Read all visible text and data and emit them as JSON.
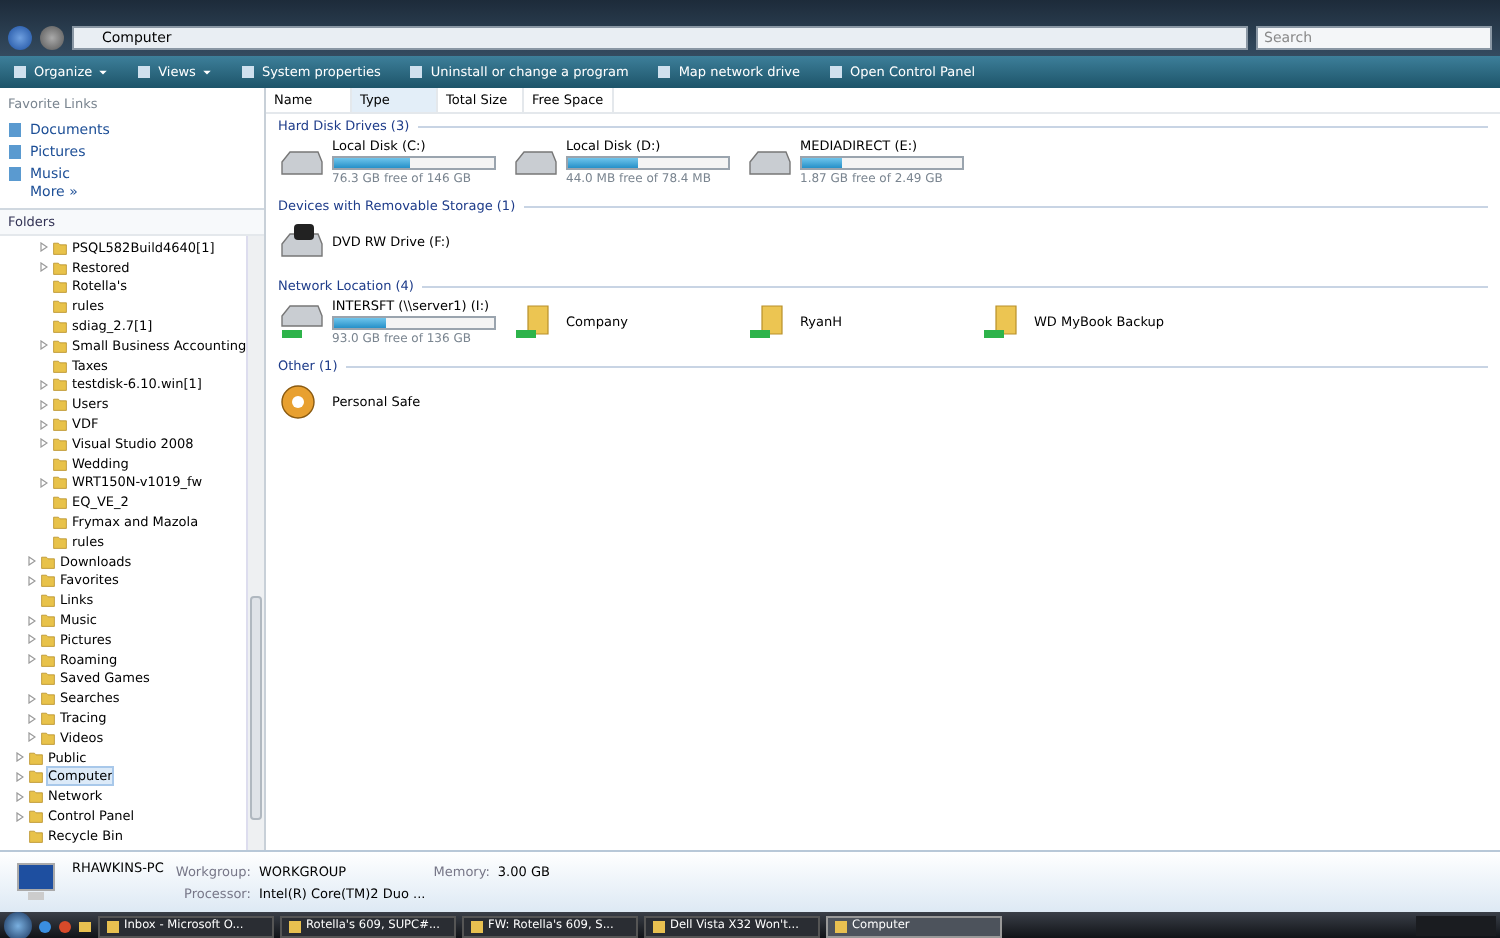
{
  "address_bar": {
    "path": "Computer",
    "search_placeholder": "Search"
  },
  "toolbar": {
    "items": [
      {
        "label": "Organize",
        "dropdown": true
      },
      {
        "label": "Views",
        "dropdown": true
      },
      {
        "label": "System properties",
        "dropdown": false
      },
      {
        "label": "Uninstall or change a program",
        "dropdown": false
      },
      {
        "label": "Map network drive",
        "dropdown": false
      },
      {
        "label": "Open Control Panel",
        "dropdown": false
      }
    ]
  },
  "favorite_links": {
    "title": "Favorite Links",
    "items": [
      {
        "label": "Documents"
      },
      {
        "label": "Pictures"
      },
      {
        "label": "Music"
      }
    ],
    "more": "More",
    "more_icon": "»"
  },
  "folders": {
    "title": "Folders",
    "nested_items": [
      {
        "label": "PSQL582Build4640[1]",
        "expandable": true,
        "selected": false
      },
      {
        "label": "Restored",
        "expandable": true,
        "selected": false
      },
      {
        "label": "Rotella's",
        "expandable": false,
        "selected": false
      },
      {
        "label": "rules",
        "expandable": false,
        "selected": false
      },
      {
        "label": "sdiag_2.7[1]",
        "expandable": false,
        "selected": false
      },
      {
        "label": "Small Business Accounting",
        "expandable": true,
        "selected": false
      },
      {
        "label": "Taxes",
        "expandable": false,
        "selected": false
      },
      {
        "label": "testdisk-6.10.win[1]",
        "expandable": true,
        "selected": false
      },
      {
        "label": "Users",
        "expandable": true,
        "selected": false
      },
      {
        "label": "VDF",
        "expandable": true,
        "selected": false
      },
      {
        "label": "Visual Studio 2008",
        "expandable": true,
        "selected": false
      },
      {
        "label": "Wedding",
        "expandable": false,
        "selected": false
      },
      {
        "label": "WRT150N-v1019_fw",
        "expandable": true,
        "selected": false
      },
      {
        "label": "EQ_VE_2",
        "expandable": false,
        "selected": false
      },
      {
        "label": "Frymax and Mazola",
        "expandable": false,
        "selected": false
      },
      {
        "label": "rules",
        "expandable": false,
        "selected": false
      }
    ],
    "user_items": [
      {
        "label": "Downloads",
        "expandable": true,
        "selected": false
      },
      {
        "label": "Favorites",
        "expandable": true,
        "selected": false
      },
      {
        "label": "Links",
        "expandable": false,
        "selected": false
      },
      {
        "label": "Music",
        "expandable": true,
        "selected": false
      },
      {
        "label": "Pictures",
        "expandable": true,
        "selected": false
      },
      {
        "label": "Roaming",
        "expandable": true,
        "selected": false
      },
      {
        "label": "Saved Games",
        "expandable": false,
        "selected": false
      },
      {
        "label": "Searches",
        "expandable": true,
        "selected": false
      },
      {
        "label": "Tracing",
        "expandable": true,
        "selected": false
      },
      {
        "label": "Videos",
        "expandable": true,
        "selected": false
      }
    ],
    "root_items": [
      {
        "label": "Public",
        "expandable": true,
        "selected": false
      },
      {
        "label": "Computer",
        "expandable": true,
        "selected": true
      },
      {
        "label": "Network",
        "expandable": true,
        "selected": false
      },
      {
        "label": "Control Panel",
        "expandable": true,
        "selected": false
      },
      {
        "label": "Recycle Bin",
        "expandable": false,
        "selected": false
      }
    ]
  },
  "columns": [
    {
      "label": "Name",
      "sorted": false
    },
    {
      "label": "Type",
      "sorted": true
    },
    {
      "label": "Total Size",
      "sorted": false
    },
    {
      "label": "Free Space",
      "sorted": false
    }
  ],
  "groups": [
    {
      "title": "Hard Disk Drives (3)",
      "items": [
        {
          "kind": "drive",
          "name": "Local Disk (C:)",
          "level": 0.48,
          "info": "76.3 GB free of 146 GB"
        },
        {
          "kind": "drive",
          "name": "Local Disk (D:)",
          "level": 0.44,
          "info": "44.0 MB free of 78.4 MB"
        },
        {
          "kind": "drive",
          "name": "MEDIADIRECT (E:)",
          "level": 0.25,
          "info": "1.87 GB free of 2.49 GB"
        }
      ]
    },
    {
      "title": "Devices with Removable Storage (1)",
      "items": [
        {
          "kind": "dvd",
          "name": "DVD RW Drive (F:)"
        }
      ]
    },
    {
      "title": "Network Location (4)",
      "items": [
        {
          "kind": "network_drive",
          "name": "INTERSFT (\\\\server1) (I:)",
          "level": 0.32,
          "info": "93.0 GB free of 136 GB"
        },
        {
          "kind": "network_folder",
          "name": "Company"
        },
        {
          "kind": "network_folder",
          "name": "RyanH"
        },
        {
          "kind": "network_folder",
          "name": "WD MyBook Backup"
        }
      ]
    },
    {
      "title": "Other (1)",
      "items": [
        {
          "kind": "safe",
          "name": "Personal Safe"
        }
      ]
    }
  ],
  "details": {
    "computer_name": "RHAWKINS-PC",
    "fields": [
      {
        "label": "Workgroup:",
        "value": "WORKGROUP"
      },
      {
        "label": "Memory:",
        "value": "3.00 GB"
      },
      {
        "label": "Processor:",
        "value": "Intel(R) Core(TM)2 Duo ..."
      }
    ]
  },
  "taskbar": {
    "buttons": [
      {
        "label": "Inbox - Microsoft O...",
        "selected": false
      },
      {
        "label": "Rotella's 609, SUPC#...",
        "selected": false
      },
      {
        "label": "FW: Rotella's 609, S...",
        "selected": false
      },
      {
        "label": "Dell Vista X32 Won't...",
        "selected": false
      },
      {
        "label": "Computer",
        "selected": true
      }
    ]
  }
}
